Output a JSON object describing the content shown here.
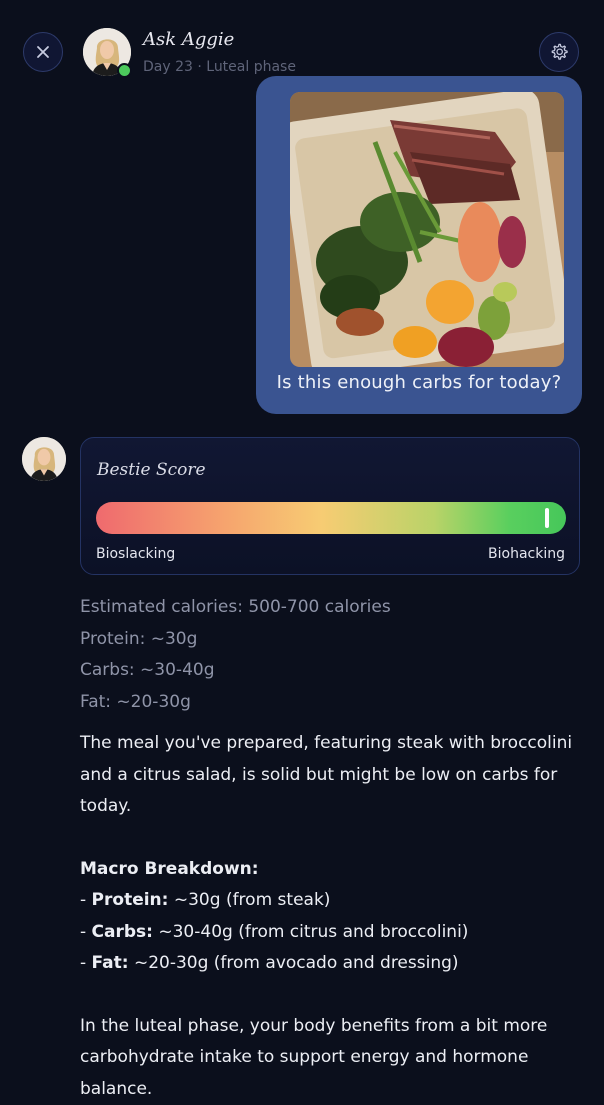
{
  "header": {
    "title": "Ask Aggie",
    "subtitle": "Day 23 · Luteal phase",
    "close_icon": "close-icon",
    "settings_icon": "gear-icon"
  },
  "user_message": {
    "text": "Is this enough carbs for today?",
    "bubble_color": "#3a5491"
  },
  "score_card": {
    "title": "Bestie Score",
    "low_label": "Bioslacking",
    "high_label": "Biohacking",
    "score_fraction": 0.96
  },
  "nutrition": {
    "calories": "Estimated calories: 500-700 calories",
    "protein": "Protein: ~30g",
    "carbs": "Carbs: ~30-40g",
    "fat": "Fat: ~20-30g"
  },
  "reply": {
    "intro": "The meal you've prepared, featuring steak with broccolini and a citrus salad, is solid but might be low on carbs for today.",
    "macro_heading": "Macro Breakdown:",
    "macros": [
      {
        "label": "Protein:",
        "value": " ~30g (from steak)"
      },
      {
        "label": "Carbs:",
        "value": " ~30-40g (from citrus and broccolini)"
      },
      {
        "label": "Fat:",
        "value": " ~20-30g (from avocado and dressing)"
      }
    ],
    "closing": "In the luteal phase, your body benefits from a bit more carbohydrate intake to support energy and hormone balance."
  }
}
